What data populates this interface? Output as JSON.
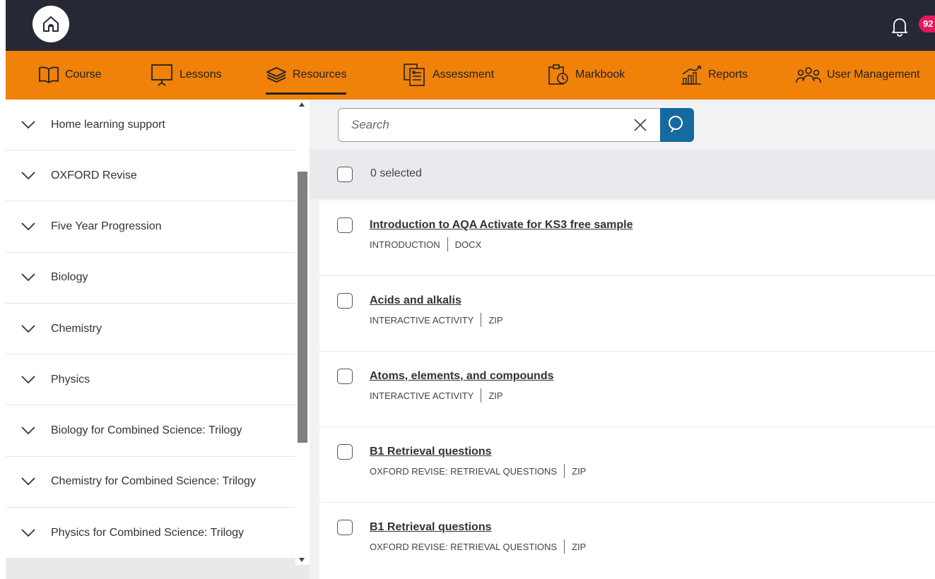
{
  "header": {
    "home_icon": "home-icon",
    "bell_icon": "bell-icon",
    "notification_count": "92"
  },
  "nav": {
    "items": [
      {
        "label": "Course",
        "icon": "book-icon"
      },
      {
        "label": "Lessons",
        "icon": "presentation-icon"
      },
      {
        "label": "Resources",
        "icon": "layers-icon",
        "active": true
      },
      {
        "label": "Assessment",
        "icon": "clipboard-icon"
      },
      {
        "label": "Markbook",
        "icon": "markbook-clock-icon"
      },
      {
        "label": "Reports",
        "icon": "bar-chart-icon"
      },
      {
        "label": "User Management",
        "icon": "users-icon"
      }
    ]
  },
  "sidebar": {
    "items": [
      {
        "label": "Home learning support"
      },
      {
        "label": "OXFORD Revise"
      },
      {
        "label": "Five Year Progression"
      },
      {
        "label": "Biology"
      },
      {
        "label": "Chemistry"
      },
      {
        "label": "Physics"
      },
      {
        "label": "Biology for Combined Science: Trilogy"
      },
      {
        "label": "Chemistry for Combined Science: Trilogy"
      },
      {
        "label": "Physics for Combined Science: Trilogy"
      }
    ]
  },
  "search": {
    "placeholder": "Search",
    "value": ""
  },
  "selection": {
    "label": "0 selected"
  },
  "resources": [
    {
      "title": "Introduction to AQA Activate for KS3 free sample",
      "type": "INTRODUCTION",
      "format": "DOCX"
    },
    {
      "title": "Acids and alkalis",
      "type": "INTERACTIVE ACTIVITY",
      "format": "ZIP"
    },
    {
      "title": "Atoms, elements, and compounds",
      "type": "INTERACTIVE ACTIVITY",
      "format": "ZIP"
    },
    {
      "title": "B1 Retrieval questions",
      "type": "OXFORD REVISE: RETRIEVAL QUESTIONS",
      "format": "ZIP"
    },
    {
      "title": "B1 Retrieval questions",
      "type": "OXFORD REVISE: RETRIEVAL QUESTIONS",
      "format": "ZIP"
    }
  ],
  "colors": {
    "topbar": "#262836",
    "navbar": "#f08109",
    "badge": "#e8175d",
    "search_button": "#156b9f"
  }
}
